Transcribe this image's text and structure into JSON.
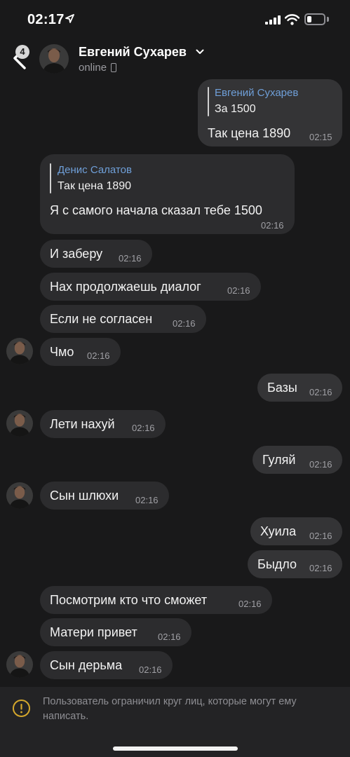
{
  "status_bar": {
    "time": "02:17"
  },
  "header": {
    "unread_count": "4",
    "contact_name": "Евгений Сухарев",
    "status": "online"
  },
  "messages": [
    {
      "dir": "out",
      "reply_name": "Евгений Сухарев",
      "reply_text": "За 1500",
      "text": "Так цена 1890",
      "time": "02:15"
    },
    {
      "dir": "in",
      "reply_name": "Денис Салатов",
      "reply_text": "Так цена 1890",
      "text": "Я с самого начала сказал тебе 1500",
      "time": "02:16"
    },
    {
      "dir": "in",
      "text": "И заберу",
      "time": "02:16"
    },
    {
      "dir": "in",
      "text": "Нах продолжаешь диалог",
      "time": "02:16"
    },
    {
      "dir": "in",
      "text": "Если не согласен",
      "time": "02:16"
    },
    {
      "dir": "in",
      "text": "Чмо",
      "time": "02:16"
    },
    {
      "dir": "out",
      "text": "Базы",
      "time": "02:16"
    },
    {
      "dir": "in",
      "text": "Лети нахуй",
      "time": "02:16"
    },
    {
      "dir": "out",
      "text": "Гуляй",
      "time": "02:16"
    },
    {
      "dir": "in",
      "text": "Сын шлюхи",
      "time": "02:16"
    },
    {
      "dir": "out",
      "text": "Хуила",
      "time": "02:16"
    },
    {
      "dir": "out",
      "text": "Быдло",
      "time": "02:16"
    },
    {
      "dir": "in",
      "text": "Посмотрим кто что сможет",
      "time": "02:16"
    },
    {
      "dir": "in",
      "text": "Матери привет",
      "time": "02:16"
    },
    {
      "dir": "in",
      "text": "Сын дерьма",
      "time": "02:16"
    }
  ],
  "notice": {
    "text": "Пользователь ограничил круг лиц, которые могут ему написать.",
    "icon": "warning-circle-icon"
  },
  "colors": {
    "background": "#19191a",
    "bubble_in": "#2c2c2e",
    "bubble_out": "#343436",
    "reply_name": "#6f9fd8",
    "notice_icon": "#d4a72c"
  }
}
